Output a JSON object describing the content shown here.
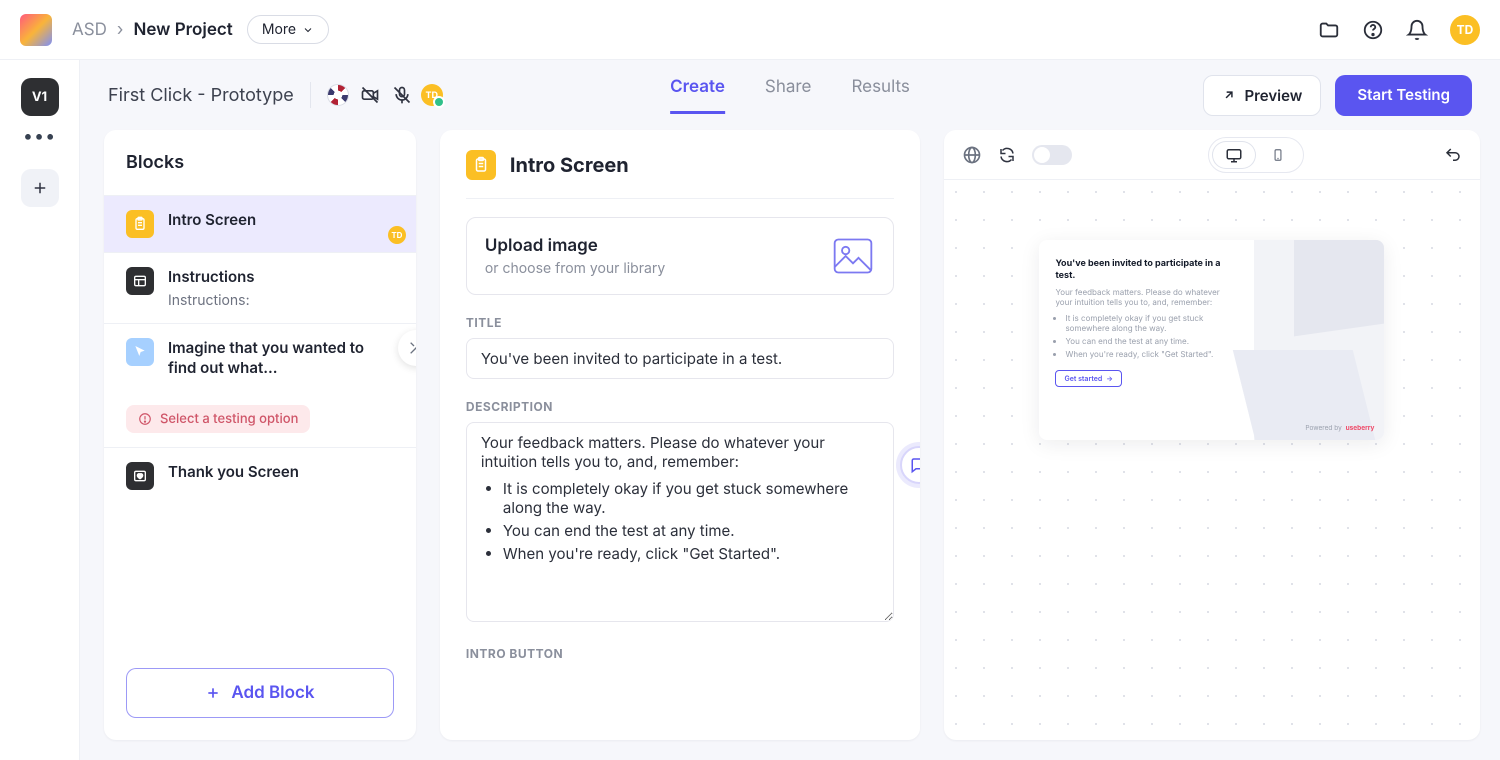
{
  "header": {
    "workspace": "ASD",
    "project": "New Project",
    "more_label": "More",
    "avatar_initials": "TD"
  },
  "rail": {
    "version_label": "V1"
  },
  "subheader": {
    "test_title": "First Click - Prototype",
    "avatar_initials": "TD",
    "tabs": {
      "create": "Create",
      "share": "Share",
      "results": "Results"
    },
    "preview_label": "Preview",
    "start_label": "Start Testing"
  },
  "blocks": {
    "heading": "Blocks",
    "items": [
      {
        "title": "Intro Screen"
      },
      {
        "title": "Instructions",
        "sub": "Instructions:"
      },
      {
        "title": "Imagine that you wanted to find out what...",
        "warning": "Select a testing option"
      },
      {
        "title": "Thank you Screen"
      }
    ],
    "add_label": "Add Block"
  },
  "editor": {
    "heading": "Intro Screen",
    "upload": {
      "title": "Upload image",
      "sub": "or choose from your library"
    },
    "labels": {
      "title": "TITLE",
      "description": "DESCRIPTION",
      "intro_button": "INTRO BUTTON"
    },
    "title_value": "You've been invited to participate in a test.",
    "description_intro": "Your feedback matters. Please do whatever your intuition tells you to, and, remember:",
    "description_bullets": [
      "It is completely okay if you get stuck somewhere along the way.",
      "You can end the test at any time.",
      "When you're ready, click \"Get Started\"."
    ]
  },
  "preview": {
    "mock": {
      "heading": "You've been invited to participate in a test.",
      "para": "Your feedback matters. Please do whatever your intuition tells you to, and, remember:",
      "bullets": [
        "It is completely okay if you get stuck somewhere along the way.",
        "You can end the test at any time.",
        "When you're ready, click \"Get Started\"."
      ],
      "button": "Get started",
      "powered": "Powered by",
      "brand": "useberry"
    }
  }
}
